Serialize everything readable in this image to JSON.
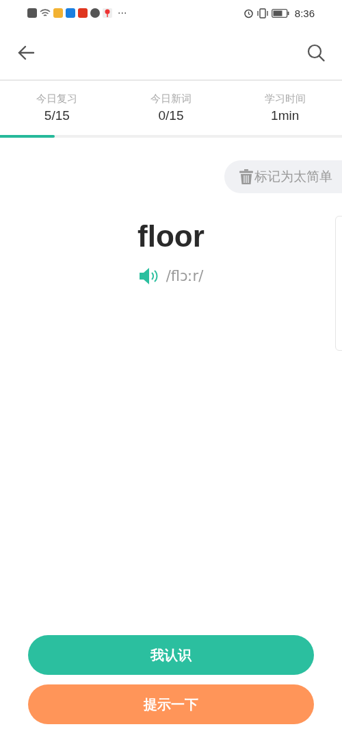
{
  "status_bar": {
    "overflow": "···",
    "time": "8:36"
  },
  "stats": [
    {
      "label": "今日复习",
      "value": "5/15"
    },
    {
      "label": "今日新词",
      "value": "0/15"
    },
    {
      "label": "学习时间",
      "value": "1min"
    }
  ],
  "progress": {
    "level": 0.16
  },
  "mark_button": {
    "label": "标记为太简单"
  },
  "word": {
    "text": "floor",
    "phonetic": "/flɔːr/"
  },
  "buttons": [
    {
      "kind": "know",
      "label": "我认识"
    },
    {
      "kind": "hint",
      "label": "提示一下"
    }
  ]
}
